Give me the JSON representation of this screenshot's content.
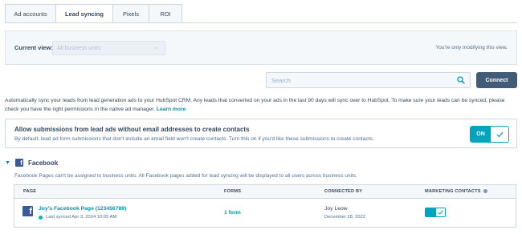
{
  "tabs": [
    {
      "label": "Ad accounts",
      "active": false
    },
    {
      "label": "Lead syncing",
      "active": true
    },
    {
      "label": "Pixels",
      "active": false
    },
    {
      "label": "ROI",
      "active": false
    }
  ],
  "view": {
    "label": "Current view:",
    "select_value": "All business units",
    "note": "You're only modifying this view."
  },
  "search": {
    "placeholder": "Search",
    "value": ""
  },
  "connect_label": "Connect",
  "description": {
    "text": "Automatically sync your leads from lead generation ads to your HubSpot CRM. Any leads that converted on your ads in the last 90 days will sync over to HubSpot. To make sure your leads can be synced, please check you have the right permissions in the native ad manager.",
    "link": "Learn more"
  },
  "allow_submissions": {
    "title": "Allow submissions from lead ads without email addresses to create contacts",
    "subtitle": "By default, lead ad form submissions that don't include an email field won't create contacts. Turn this on if you'd like these submissions to create contacts.",
    "toggle_label": "ON",
    "enabled": true
  },
  "facebook": {
    "title": "Facebook",
    "note": "Facebook Pages can't be assigned to business units. All Facebook pages added for lead syncing will be displayed to all users across business units.",
    "columns": {
      "page": "PAGE",
      "forms": "FORMS",
      "connected_by": "CONNECTED BY",
      "marketing_contacts": "MARKETING CONTACTS"
    },
    "rows": [
      {
        "page_name": "Joy's Facebook Page (123456789)",
        "last_synced": "Last synced Apr 3, 2024 10:05 AM",
        "forms": "1 form",
        "connected_by": "Joy Leow",
        "connected_date": "December 28, 2022",
        "marketing_contacts": true
      }
    ]
  },
  "colors": {
    "accent": "#00a4bd",
    "link": "#0091ae",
    "connect_button": "#425b76",
    "facebook": "#3b5998",
    "status_ok": "#00bda5"
  }
}
